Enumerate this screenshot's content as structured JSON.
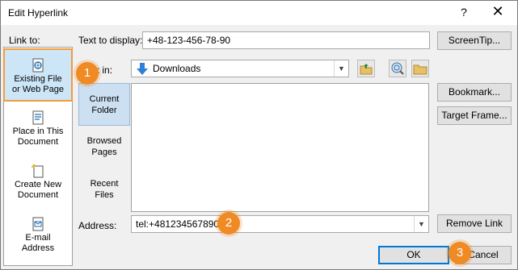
{
  "window": {
    "title": "Edit Hyperlink",
    "help_glyph": "?",
    "close_glyph": "✕"
  },
  "sidebar": {
    "heading": "Link to:",
    "items": [
      {
        "line1": "Existing File",
        "line2": "or Web Page",
        "icon": "web-page-icon"
      },
      {
        "line1": "Place in This",
        "line2": "Document",
        "icon": "document-place-icon"
      },
      {
        "line1": "Create New",
        "line2": "Document",
        "icon": "new-document-icon"
      },
      {
        "line1": "E-mail",
        "line2": "Address",
        "icon": "email-icon"
      }
    ]
  },
  "text_to_display": {
    "label": "Text to display:",
    "value": "+48-123-456-78-90"
  },
  "look_in": {
    "label": "Look in:",
    "value": "Downloads"
  },
  "folder_tabs": [
    {
      "line1": "Current",
      "line2": "Folder"
    },
    {
      "line1": "Browsed",
      "line2": "Pages"
    },
    {
      "line1": "Recent",
      "line2": "Files"
    }
  ],
  "address": {
    "label": "Address:",
    "value": "tel:+481234567890"
  },
  "buttons": {
    "screentip": "ScreenTip...",
    "bookmark": "Bookmark...",
    "target_frame": "Target Frame...",
    "remove_link": "Remove Link",
    "ok": "OK",
    "cancel": "Cancel"
  },
  "badges": [
    "1",
    "2",
    "3"
  ],
  "colors": {
    "badge": "#f08a24",
    "highlight_border": "#f39c3a",
    "selection": "#cde6f7"
  }
}
